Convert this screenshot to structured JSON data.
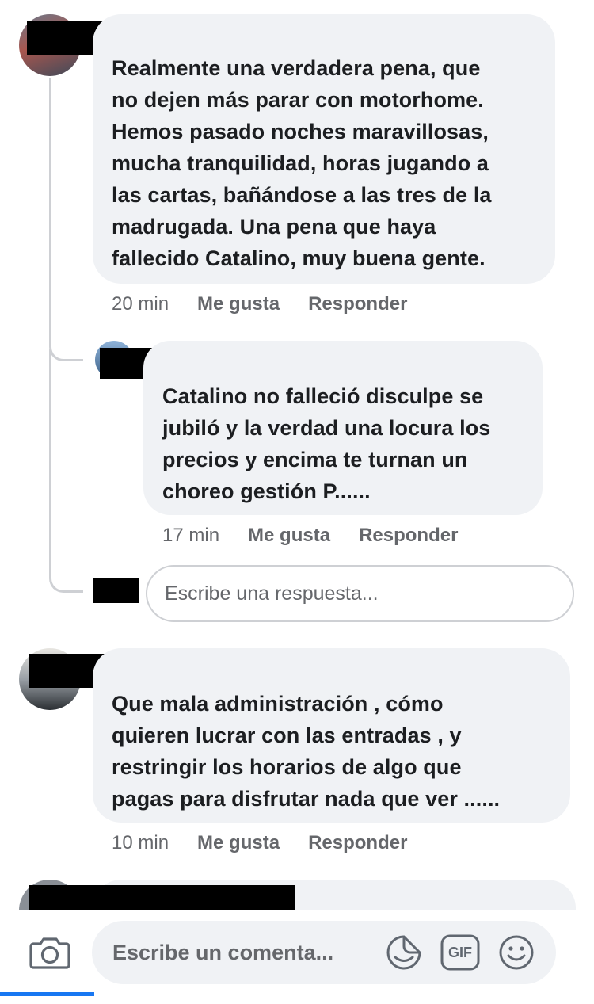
{
  "comments": [
    {
      "text": "Realmente una verdadera pena, que\nno dejen más parar con motorhome.\nHemos pasado noches maravillosas,\nmucha tranquilidad, horas jugando a\nlas cartas, bañándose a las tres de la\nmadrugada. Una pena que haya\nfallecido Catalino, muy buena gente.",
      "time": "20 min",
      "like_label": "Me gusta",
      "reply_label": "Responder",
      "reply": {
        "text": "Catalino no falleció disculpe se\njubiló y la verdad una locura los\nprecios y encima te turnan un\nchoreo gestión P......",
        "time": "17 min",
        "like_label": "Me gusta",
        "reply_label": "Responder"
      },
      "reply_input_placeholder": "Escribe una respuesta..."
    },
    {
      "text": "Que mala administración , cómo\nquieren lucrar con las entradas , y\nrestringir los horarios de algo que\npagas para disfrutar nada que ver ......",
      "time": "10 min",
      "like_label": "Me gusta",
      "reply_label": "Responder"
    }
  ],
  "composer": {
    "placeholder": "Escribe un comenta...",
    "icons": [
      "camera-icon",
      "sticker-icon",
      "gif-icon",
      "emoji-icon"
    ],
    "gif_label": "GIF"
  },
  "colors": {
    "bubble": "#f0f2f5",
    "meta": "#65676b",
    "text": "#1c1e21",
    "accent": "#1877f2"
  }
}
